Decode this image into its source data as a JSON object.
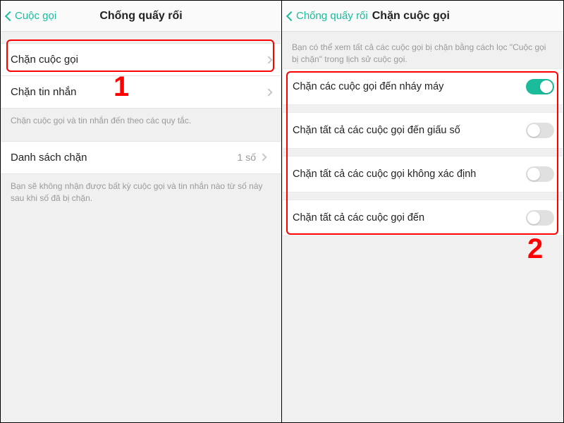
{
  "left": {
    "back_label": "Cuộc gọi",
    "title": "Chống quấy rối",
    "rows": {
      "block_calls": "Chặn cuộc gọi",
      "block_sms": "Chặn tin nhắn"
    },
    "hint1": "Chặn cuộc gọi và tin nhắn đến theo các quy tắc.",
    "blocklist_label": "Danh sách chặn",
    "blocklist_count": "1 số",
    "hint2": "Bạn sẽ không nhận được bất kỳ cuộc gọi và tin nhắn nào từ số này sau khi số đã bị chặn."
  },
  "right": {
    "back_label": "Chống quấy rối",
    "title": "Chặn cuộc gọi",
    "hint_top": "Bạn có thể xem tất cả các cuộc gọi bị chặn bằng cách lọc \"Cuộc gọi bị chặn\" trong lịch sử cuộc gọi.",
    "toggles": [
      {
        "label": "Chặn các cuộc gọi đến nháy máy",
        "on": true
      },
      {
        "label": "Chặn tất cả các cuộc gọi đến giấu số",
        "on": false
      },
      {
        "label": "Chặn tất cả các cuộc gọi không xác định",
        "on": false
      },
      {
        "label": "Chặn tất cả các cuộc gọi đến",
        "on": false
      }
    ]
  },
  "annotations": {
    "num1": "1",
    "num2": "2"
  }
}
